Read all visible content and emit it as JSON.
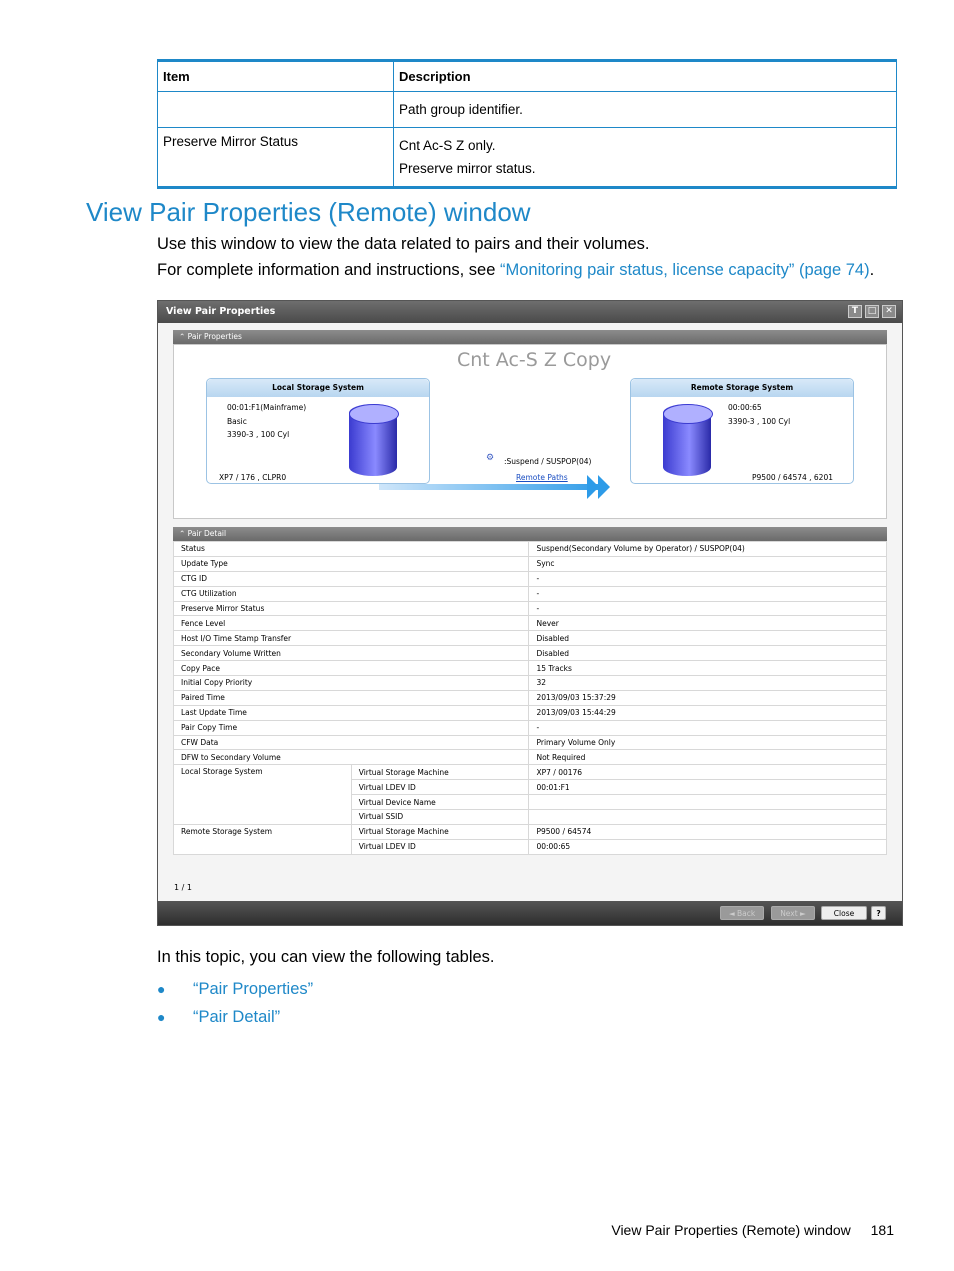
{
  "top_table": {
    "headers": [
      "Item",
      "Description"
    ],
    "rows": [
      {
        "item": "",
        "desc": [
          "Path group identifier."
        ]
      },
      {
        "item": "Preserve Mirror Status",
        "desc": [
          "Cnt Ac-S Z only.",
          "Preserve mirror status."
        ]
      }
    ]
  },
  "section": {
    "title": "View Pair Properties (Remote) window",
    "intro": "Use this window to view the data related to pairs and their volumes.",
    "info_prefix": "For complete information and instructions, see ",
    "info_link": "“Monitoring pair status, license capacity” (page 74)",
    "info_suffix": "."
  },
  "window": {
    "title": "View Pair Properties",
    "title_buttons": [
      "T",
      "□",
      "✕"
    ],
    "pair_properties": {
      "header": "Pair Properties",
      "copy_type": "Cnt Ac-S Z Copy",
      "local": {
        "title": "Local Storage System",
        "lines": [
          "00:01:F1(Mainframe)",
          "Basic",
          "3390-3 , 100 Cyl"
        ],
        "footer": "XP7 / 176 , CLPR0"
      },
      "remote": {
        "title": "Remote Storage System",
        "lines": [
          "00:00:65",
          "3390-3 , 100 Cyl"
        ],
        "footer": "P9500 / 64574 , 6201"
      },
      "status": ":Suspend / SUSPOP(04)",
      "paths_link": "Remote Paths"
    },
    "pair_detail": {
      "header": "Pair Detail",
      "rows": [
        {
          "label": "Status",
          "value": "Suspend(Secondary Volume by Operator) / SUSPOP(04)"
        },
        {
          "label": "Update Type",
          "value": "Sync"
        },
        {
          "label": "CTG ID",
          "value": "-"
        },
        {
          "label": "CTG Utilization",
          "value": "-"
        },
        {
          "label": "Preserve Mirror Status",
          "value": "-"
        },
        {
          "label": "Fence Level",
          "value": "Never"
        },
        {
          "label": "Host I/O Time Stamp Transfer",
          "value": "Disabled"
        },
        {
          "label": "Secondary Volume Written",
          "value": "Disabled"
        },
        {
          "label": "Copy Pace",
          "value": "15 Tracks"
        },
        {
          "label": "Initial Copy Priority",
          "value": "32"
        },
        {
          "label": "Paired Time",
          "value": "2013/09/03 15:37:29"
        },
        {
          "label": "Last Update Time",
          "value": "2013/09/03 15:44:29"
        },
        {
          "label": "Pair Copy Time",
          "value": "-"
        },
        {
          "label": "CFW Data",
          "value": "Primary Volume Only"
        },
        {
          "label": "DFW to Secondary Volume",
          "value": "Not Required"
        }
      ],
      "local_group": {
        "label": "Local Storage System",
        "rows": [
          {
            "label": "Virtual Storage Machine",
            "value": "XP7 / 00176"
          },
          {
            "label": "Virtual LDEV ID",
            "value": "00:01:F1"
          },
          {
            "label": "Virtual Device Name",
            "value": ""
          },
          {
            "label": "Virtual SSID",
            "value": ""
          }
        ]
      },
      "remote_group": {
        "label": "Remote Storage System",
        "rows": [
          {
            "label": "Virtual Storage Machine",
            "value": "P9500 / 64574"
          },
          {
            "label": "Virtual LDEV ID",
            "value": "00:00:65"
          }
        ]
      }
    },
    "pager": "1 / 1",
    "buttons": {
      "back": "◄ Back",
      "next": "Next ►",
      "close": "Close",
      "help": "?"
    }
  },
  "after": {
    "text": "In this topic, you can view the following tables.",
    "bullets": [
      "“Pair Properties”",
      "“Pair Detail”"
    ]
  },
  "footer": {
    "title": "View Pair Properties (Remote) window",
    "page": "181"
  }
}
